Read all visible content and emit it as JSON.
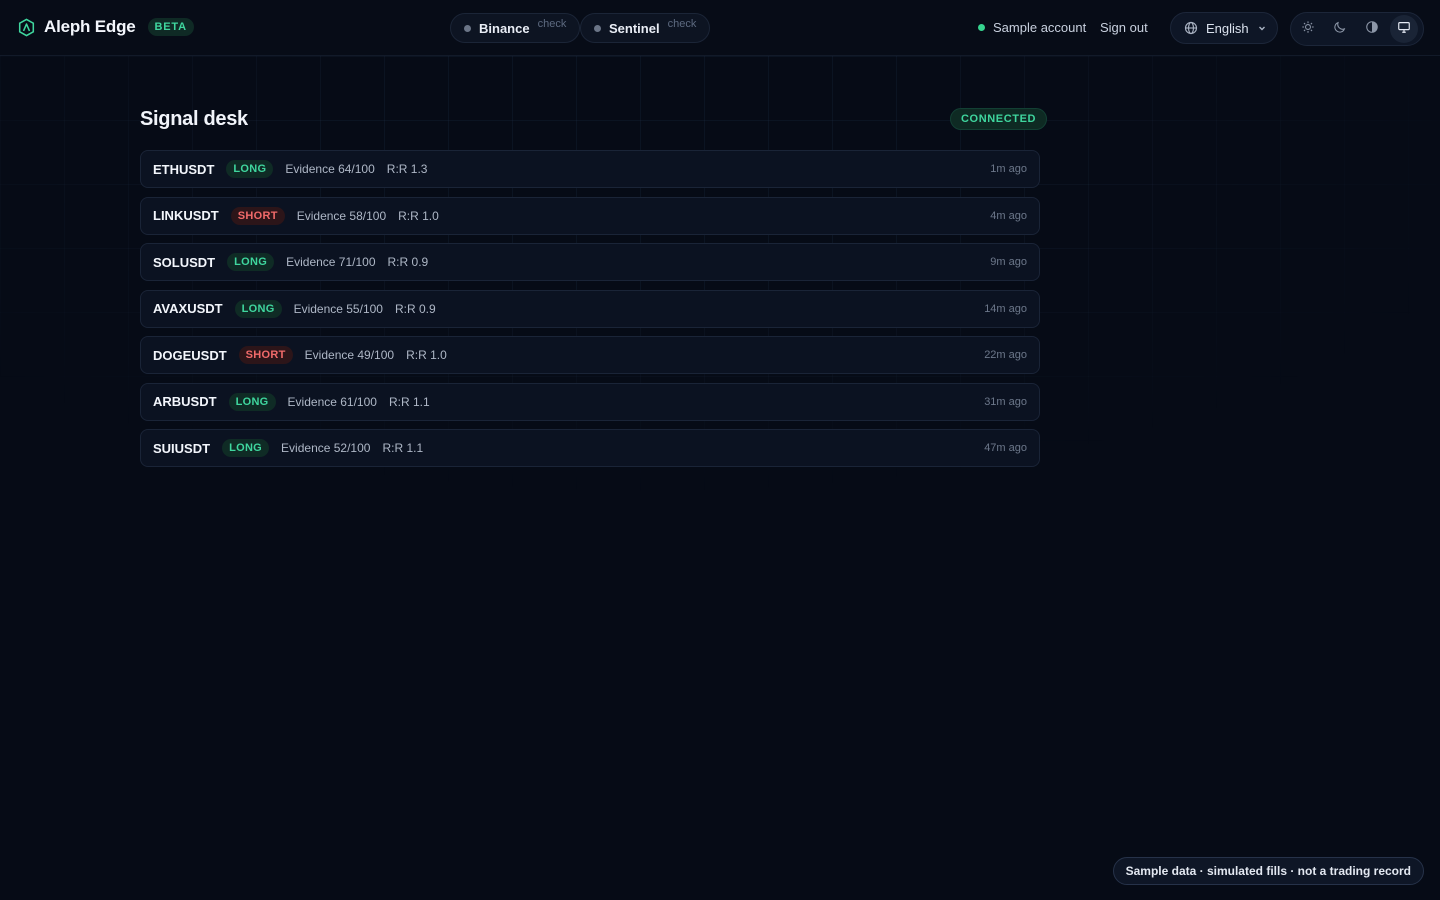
{
  "header": {
    "brand_name": "Aleph Edge",
    "beta_label": "BETA",
    "pills": [
      {
        "name": "Binance",
        "check": "check"
      },
      {
        "name": "Sentinel",
        "check": "check"
      }
    ],
    "account_label": "Sample account",
    "signout_label": "Sign out",
    "language": "English",
    "theme_options": [
      "sun-icon",
      "moon-icon",
      "contrast-icon",
      "monitor-icon"
    ],
    "active_theme": "monitor-icon"
  },
  "main": {
    "title": "Signal desk",
    "status": "CONNECTED",
    "signals": [
      {
        "symbol": "ETHUSDT",
        "side": "LONG",
        "evidence": "Evidence 64/100",
        "rr": "R:R 1.3",
        "time": "1m ago"
      },
      {
        "symbol": "LINKUSDT",
        "side": "SHORT",
        "evidence": "Evidence 58/100",
        "rr": "R:R 1.0",
        "time": "4m ago"
      },
      {
        "symbol": "SOLUSDT",
        "side": "LONG",
        "evidence": "Evidence 71/100",
        "rr": "R:R 0.9",
        "time": "9m ago"
      },
      {
        "symbol": "AVAXUSDT",
        "side": "LONG",
        "evidence": "Evidence 55/100",
        "rr": "R:R 0.9",
        "time": "14m ago"
      },
      {
        "symbol": "DOGEUSDT",
        "side": "SHORT",
        "evidence": "Evidence 49/100",
        "rr": "R:R 1.0",
        "time": "22m ago"
      },
      {
        "symbol": "ARBUSDT",
        "side": "LONG",
        "evidence": "Evidence 61/100",
        "rr": "R:R 1.1",
        "time": "31m ago"
      },
      {
        "symbol": "SUIUSDT",
        "side": "LONG",
        "evidence": "Evidence 52/100",
        "rr": "R:R 1.1",
        "time": "47m ago"
      }
    ]
  },
  "footer_note": "Sample data · simulated fills · not a trading record",
  "colors": {
    "accent": "#3fd69e",
    "short": "#f06a6a",
    "background": "#060b16"
  }
}
